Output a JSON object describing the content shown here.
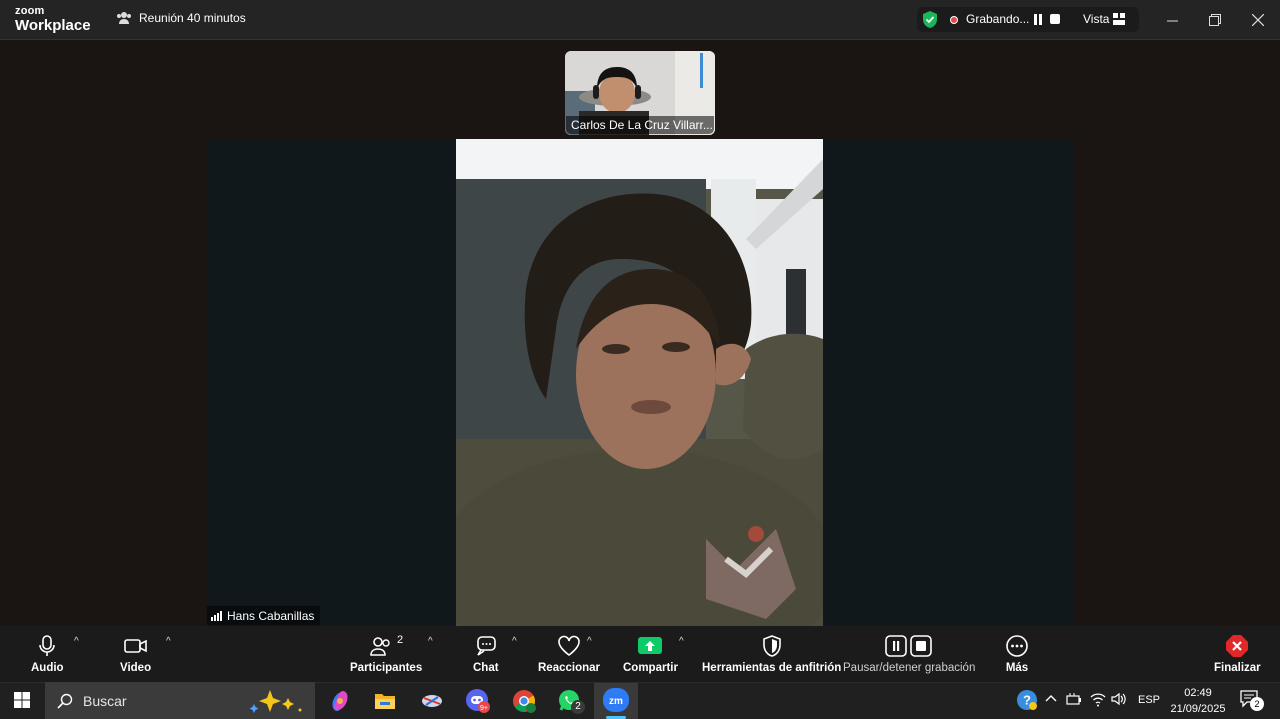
{
  "titlebar": {
    "brand_top": "zoom",
    "brand_bottom": "Workplace",
    "meeting_title": "Reunión 40 minutos",
    "recording_label": "Grabando...",
    "view_label": "Vista"
  },
  "video": {
    "thumbnail_name": "Carlos De La Cruz Villarr...",
    "main_name": "Hans Cabanillas"
  },
  "toolbar": {
    "audio_label": "Audio",
    "video_label": "Video",
    "participants_label": "Participantes",
    "participants_count": "2",
    "chat_label": "Chat",
    "react_label": "Reaccionar",
    "share_label": "Compartir",
    "host_tools_label": "Herramientas de anfitrión",
    "recording_control_label": "Pausar/detener grabación",
    "more_label": "Más",
    "end_label": "Finalizar"
  },
  "taskbar": {
    "search_placeholder": "Buscar",
    "whatsapp_badge": "2",
    "language": "ESP",
    "time": "02:49",
    "date": "21/09/2025",
    "notification_count": "2"
  },
  "colors": {
    "share_green": "#0ecb6a",
    "end_red": "#e02828",
    "rec_red": "#e5484d"
  }
}
